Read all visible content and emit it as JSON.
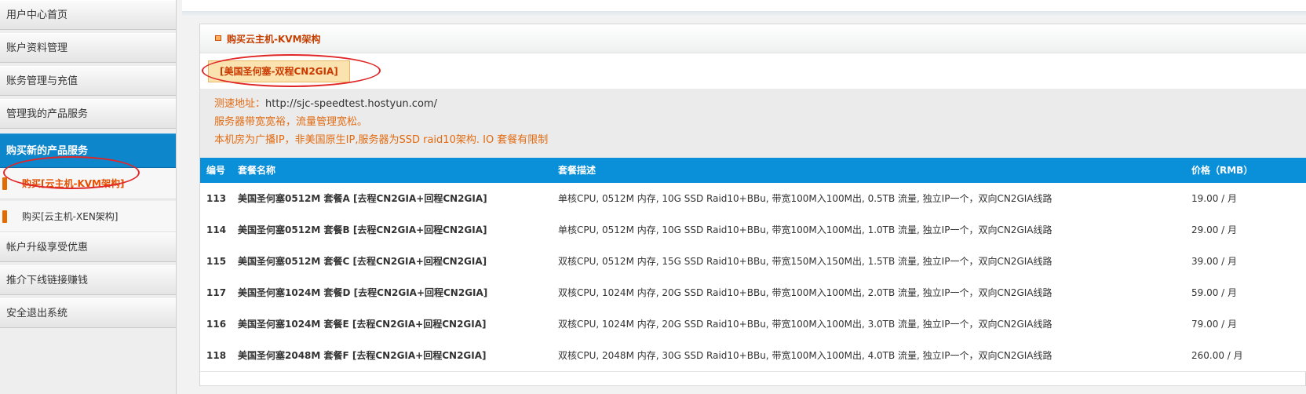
{
  "sidebar": {
    "items": [
      {
        "label": "用户中心首页"
      },
      {
        "label": "账户资料管理"
      },
      {
        "label": "账务管理与充值"
      },
      {
        "label": "管理我的产品服务"
      },
      {
        "label": "购买新的产品服务"
      },
      {
        "label": "帐户升级享受优惠"
      },
      {
        "label": "推介下线链接赚钱"
      },
      {
        "label": "安全退出系统"
      }
    ],
    "sub_items": [
      {
        "label": "购买[云主机-KVM架构]"
      },
      {
        "label": "购买[云主机-XEN架构]"
      }
    ]
  },
  "panel": {
    "title": "购买云主机-KVM架构",
    "region_tab": "[美国圣何塞-双程CN2GIA]",
    "speedtest_label": "测速地址：",
    "speedtest_url": "http://sjc-speedtest.hostyun.com/",
    "note1": "服务器带宽宽裕，流量管理宽松。",
    "note2": "本机房为广播IP，非美国原生IP,服务器为SSD raid10架构. IO 套餐有限制"
  },
  "table": {
    "headers": [
      "编号",
      "套餐名称",
      "套餐描述",
      "价格（RMB）"
    ],
    "rows": [
      {
        "id": "113",
        "name": "美国圣何塞0512M 套餐A [去程CN2GIA+回程CN2GIA]",
        "desc": "单核CPU, 0512M 内存, 10G SSD Raid10+BBu, 带宽100M入100M出, 0.5TB 流量, 独立IP一个，双向CN2GIA线路",
        "price": "19.00 / 月"
      },
      {
        "id": "114",
        "name": "美国圣何塞0512M 套餐B [去程CN2GIA+回程CN2GIA]",
        "desc": "单核CPU, 0512M 内存, 10G SSD Raid10+BBu, 带宽100M入100M出, 1.0TB 流量, 独立IP一个，双向CN2GIA线路",
        "price": "29.00 / 月"
      },
      {
        "id": "115",
        "name": "美国圣何塞0512M 套餐C [去程CN2GIA+回程CN2GIA]",
        "desc": "双核CPU, 0512M 内存, 15G SSD Raid10+BBu, 带宽150M入150M出, 1.5TB 流量, 独立IP一个，双向CN2GIA线路",
        "price": "39.00 / 月"
      },
      {
        "id": "117",
        "name": "美国圣何塞1024M 套餐D [去程CN2GIA+回程CN2GIA]",
        "desc": "双核CPU, 1024M 内存, 20G SSD Raid10+BBu, 带宽100M入100M出, 2.0TB 流量, 独立IP一个，双向CN2GIA线路",
        "price": "59.00 / 月"
      },
      {
        "id": "116",
        "name": "美国圣何塞1024M 套餐E [去程CN2GIA+回程CN2GIA]",
        "desc": "双核CPU, 1024M 内存, 20G SSD Raid10+BBu, 带宽100M入100M出, 3.0TB 流量, 独立IP一个，双向CN2GIA线路",
        "price": "79.00 / 月"
      },
      {
        "id": "118",
        "name": "美国圣何塞2048M 套餐F [去程CN2GIA+回程CN2GIA]",
        "desc": "双核CPU, 2048M 内存, 30G SSD Raid10+BBu, 带宽100M入100M出, 4.0TB 流量, 独立IP一个，双向CN2GIA线路",
        "price": "260.00 / 月"
      }
    ]
  },
  "colors": {
    "accent": "#0a90d8",
    "highlight_text": "#e26b12",
    "annotation": "#e02626"
  }
}
